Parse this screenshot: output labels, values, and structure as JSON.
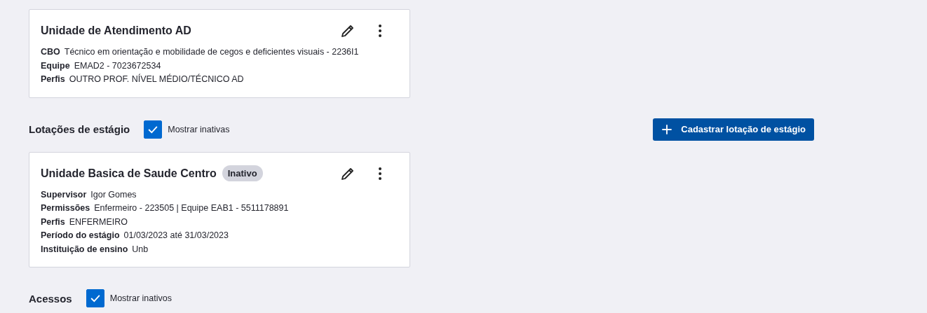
{
  "cards_top": [
    {
      "title": "Unidade de Atendimento AD",
      "fields": [
        {
          "label": "CBO",
          "value": "Técnico em orientação e mobilidade de cegos e deficientes visuais - 2236I1"
        },
        {
          "label": "Equipe",
          "value": "EMAD2 - 7023672534"
        },
        {
          "label": "Perfis",
          "value": "OUTRO PROF. NÍVEL MÉDIO/TÉCNICO AD"
        }
      ]
    }
  ],
  "sections": [
    {
      "title": "Lotações de estágio",
      "checkbox": {
        "label": "Mostrar inativas",
        "checked": true
      },
      "action": "Cadastrar lotação de estágio",
      "cards": [
        {
          "title": "Unidade Basica de Saude Centro",
          "badge": "Inativo",
          "fields": [
            {
              "label": "Supervisor",
              "value": "Igor Gomes"
            },
            {
              "label": "Permissões",
              "value": "Enfermeiro - 223505 | Equipe EAB1 - 5511178891"
            },
            {
              "label": "Perfis",
              "value": "ENFERMEIRO"
            },
            {
              "label": "Período do estágio",
              "value": "01/03/2023 até 31/03/2023"
            },
            {
              "label": "Instituição de ensino",
              "value": "Unb"
            }
          ]
        }
      ]
    },
    {
      "title": "Acessos",
      "checkbox": {
        "label": "Mostrar inativos",
        "checked": true
      }
    }
  ]
}
